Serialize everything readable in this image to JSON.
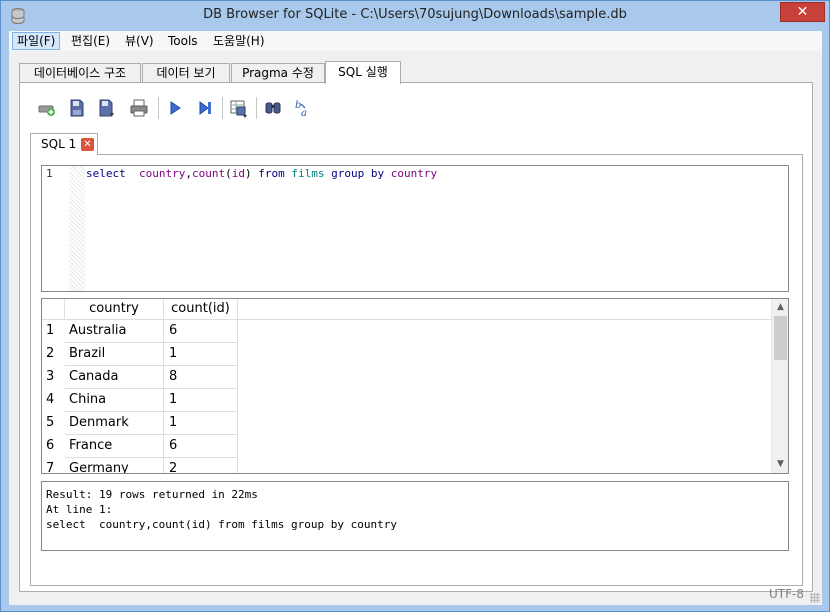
{
  "window": {
    "title": "DB Browser for SQLite - C:\\Users\\70sujung\\Downloads\\sample.db",
    "close_glyph": "✕"
  },
  "menu": [
    {
      "label": "파일(F)"
    },
    {
      "label": "편집(E)"
    },
    {
      "label": "뷰(V)"
    },
    {
      "label": "Tools"
    },
    {
      "label": "도움말(H)"
    }
  ],
  "tabs": [
    {
      "label": "데이터베이스 구조"
    },
    {
      "label": "데이터 보기"
    },
    {
      "label": "Pragma 수정"
    },
    {
      "label": "SQL 실행",
      "active": true
    }
  ],
  "toolbar": {
    "buttons": [
      {
        "icon": "open-tab-icon"
      },
      {
        "icon": "open-sql-icon"
      },
      {
        "icon": "save-sql-icon"
      },
      {
        "icon": "print-icon"
      },
      {
        "icon": "execute-all-icon"
      },
      {
        "icon": "execute-line-icon"
      },
      {
        "icon": "save-results-icon"
      },
      {
        "icon": "find-icon"
      },
      {
        "icon": "find-replace-icon"
      }
    ]
  },
  "sql_tab": {
    "label": "SQL 1",
    "close_glyph": "✕"
  },
  "editor": {
    "line_number": "1",
    "tokens": {
      "select": "select",
      "country": "country",
      "comma": ",",
      "count": "count",
      "paren_open": "(",
      "id": "id",
      "paren_close": ")",
      "from": "from",
      "films": "films",
      "group": "group",
      "by": "by",
      "country2": "country"
    }
  },
  "grid": {
    "columns": [
      "country",
      "count(id)"
    ],
    "rows": [
      {
        "n": "1",
        "country": "Australia",
        "count": "6"
      },
      {
        "n": "2",
        "country": "Brazil",
        "count": "1"
      },
      {
        "n": "3",
        "country": "Canada",
        "count": "8"
      },
      {
        "n": "4",
        "country": "China",
        "count": "1"
      },
      {
        "n": "5",
        "country": "Denmark",
        "count": "1"
      },
      {
        "n": "6",
        "country": "France",
        "count": "6"
      },
      {
        "n": "7",
        "country": "Germany",
        "count": "2"
      }
    ],
    "scroll_up": "▲",
    "scroll_down": "▼"
  },
  "result": {
    "line1": "Result: 19 rows returned in 22ms",
    "line2": "At line 1:",
    "line3": "select  country,count(id) from films group by country"
  },
  "status": {
    "encoding": "UTF-8"
  }
}
